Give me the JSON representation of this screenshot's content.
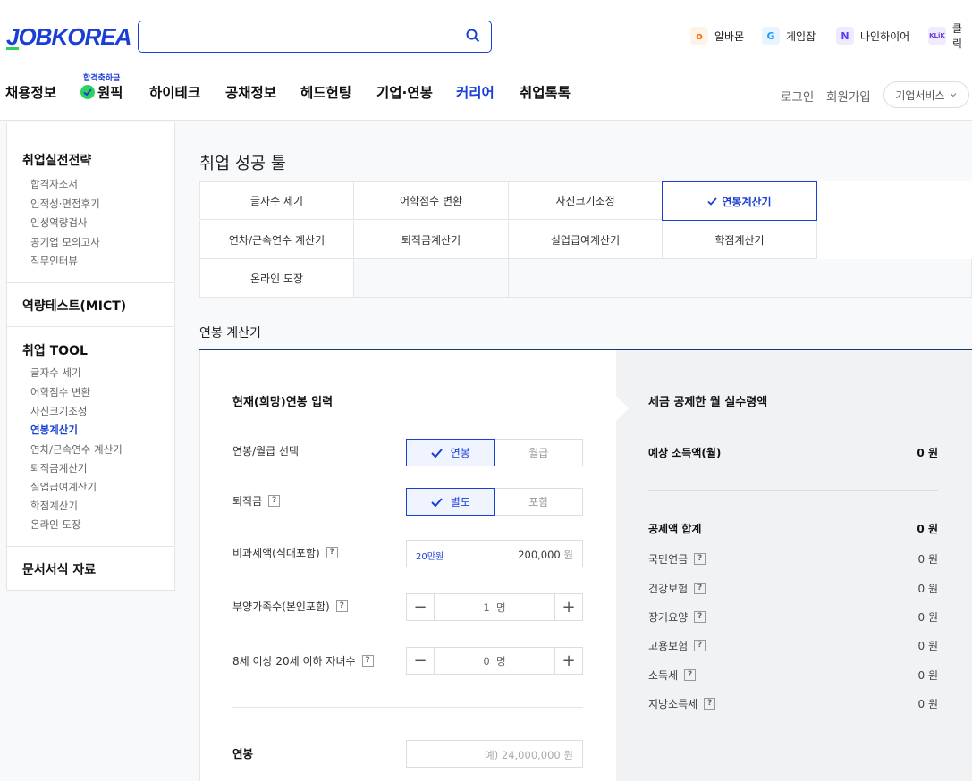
{
  "header": {
    "logo": "JOBKOREA",
    "search_placeholder": "",
    "family_sites": [
      {
        "label": "알바몬",
        "icon": "albamon-icon",
        "glyph": "o",
        "color": "#ff6a00"
      },
      {
        "label": "게임잡",
        "icon": "gamejob-icon",
        "glyph": "G",
        "color": "#1a9cff"
      },
      {
        "label": "나인하이어",
        "icon": "ninehire-icon",
        "glyph": "N",
        "color": "#5b3df5"
      },
      {
        "label": "클릭",
        "icon": "klik-icon",
        "glyph": "KLiK",
        "color": "#6a3fd6"
      }
    ],
    "gnb": [
      "채용정보",
      "원픽",
      "하이테크",
      "공채정보",
      "헤드헌팅",
      "기업·연봉",
      "커리어",
      "취업톡톡"
    ],
    "gnb_badge": "합격축하금",
    "login": "로그인",
    "signup": "회원가입",
    "corp_service": "기업서비스"
  },
  "sidebar": {
    "sections": [
      {
        "title": "취업실전전략",
        "links": [
          "합격자소서",
          "인적성·면접후기",
          "인성역량검사",
          "공기업 모의고사",
          "직무인터뷰"
        ]
      },
      {
        "title": "역량테스트(MICT)",
        "links": []
      },
      {
        "title": "취업 TOOL",
        "links": [
          "글자수 세기",
          "어학점수 변환",
          "사진크기조정",
          "연봉계산기",
          "연차/근속연수 계산기",
          "퇴직금계산기",
          "실업급여계산기",
          "학점계산기",
          "온라인 도장"
        ]
      },
      {
        "title": "문서서식 자료",
        "links": []
      }
    ],
    "active_link": "연봉계산기"
  },
  "main": {
    "page_title": "취업 성공 툴",
    "tools": [
      "글자수 세기",
      "어학점수 변환",
      "사진크기조정",
      "연봉계산기",
      "연차/근속연수 계산기",
      "퇴직금계산기",
      "실업급여계산기",
      "학점계산기",
      "온라인 도장"
    ],
    "selected_tool": "연봉계산기",
    "calc_title": "연봉 계산기"
  },
  "calculator": {
    "input_title": "현재(희망)연봉 입력",
    "salary_type_label": "연봉/월급 선택",
    "salary_type_options": [
      "연봉",
      "월급"
    ],
    "severance_label": "퇴직금",
    "severance_options": [
      "별도",
      "포함"
    ],
    "nontax_label": "비과세액(식대포함)",
    "nontax_hint": "20만원",
    "nontax_value": "200,000",
    "unit_won": "원",
    "dependents_label": "부양가족수(본인포함)",
    "dependents_value": "1",
    "children_label": "8세 이상 20세 이하 자녀수",
    "children_value": "0",
    "unit_person": "명",
    "salary_label": "연봉",
    "salary_placeholder": "예) 24,000,000",
    "help": "?"
  },
  "result": {
    "title": "세금 공제한 월 실수령액",
    "expected_label": "예상 소득액(월)",
    "expected_value": "0 원",
    "deduction_total_label": "공제액 합계",
    "deduction_total_value": "0 원",
    "items": [
      {
        "label": "국민연금",
        "value": "0 원"
      },
      {
        "label": "건강보험",
        "value": "0 원"
      },
      {
        "label": "장기요양",
        "value": "0 원"
      },
      {
        "label": "고용보험",
        "value": "0 원"
      },
      {
        "label": "소득세",
        "value": "0 원"
      },
      {
        "label": "지방소득세",
        "value": "0 원"
      }
    ]
  },
  "colors": {
    "brand": "#1a3fd6",
    "accent_green": "#2fd25c"
  }
}
